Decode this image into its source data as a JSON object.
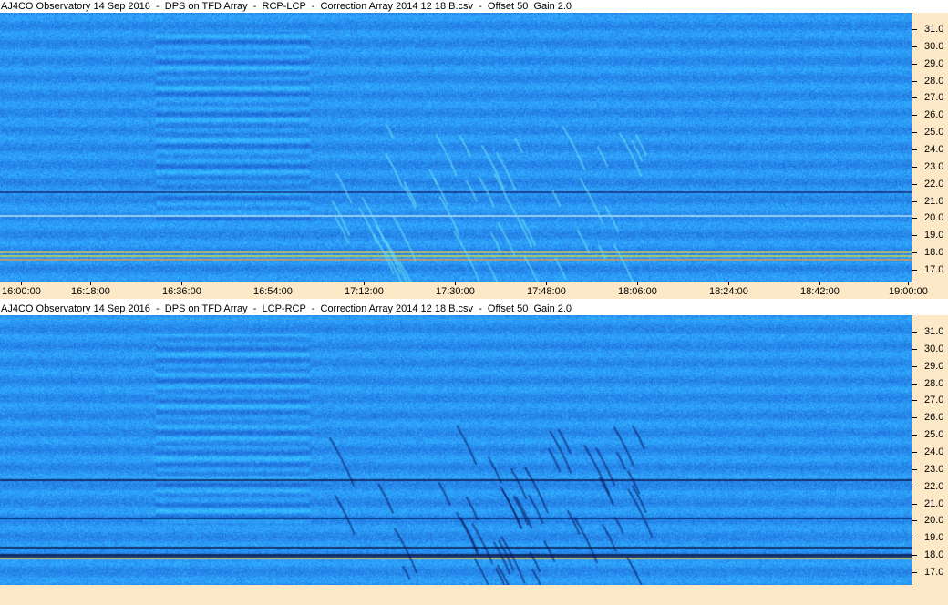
{
  "panels": [
    {
      "title": "AJ4CO Observatory 14 Sep 2016  -  DPS on TFD Array  -  RCP-LCP  -  Correction Array 2014 12 18 B.csv  -  Offset 50  Gain 2.0",
      "mode": "RCP-LCP"
    },
    {
      "title": "AJ4CO Observatory 14 Sep 2016  -  DPS on TFD Array  -  LCP-RCP  -  Correction Array 2014 12 18 B.csv  -  Offset 50  Gain 2.0",
      "mode": "LCP-RCP"
    }
  ],
  "frequency_ticks": [
    "31.0",
    "30.0",
    "29.0",
    "28.0",
    "27.0",
    "26.0",
    "25.0",
    "24.0",
    "23.0",
    "22.0",
    "21.0",
    "20.0",
    "19.0",
    "18.0",
    "17.0"
  ],
  "time_ticks": [
    "16:00:00",
    "16:18:00",
    "16:36:00",
    "16:54:00",
    "17:12:00",
    "17:30:00",
    "17:48:00",
    "18:06:00",
    "18:24:00",
    "18:42:00",
    "19:00:00"
  ],
  "colors": {
    "spectrogram_base": "#1f5fd6",
    "axis_background": "#fde9c8",
    "bright_band": "#e8e030",
    "burst_highlight": "#5fe0f0"
  }
}
